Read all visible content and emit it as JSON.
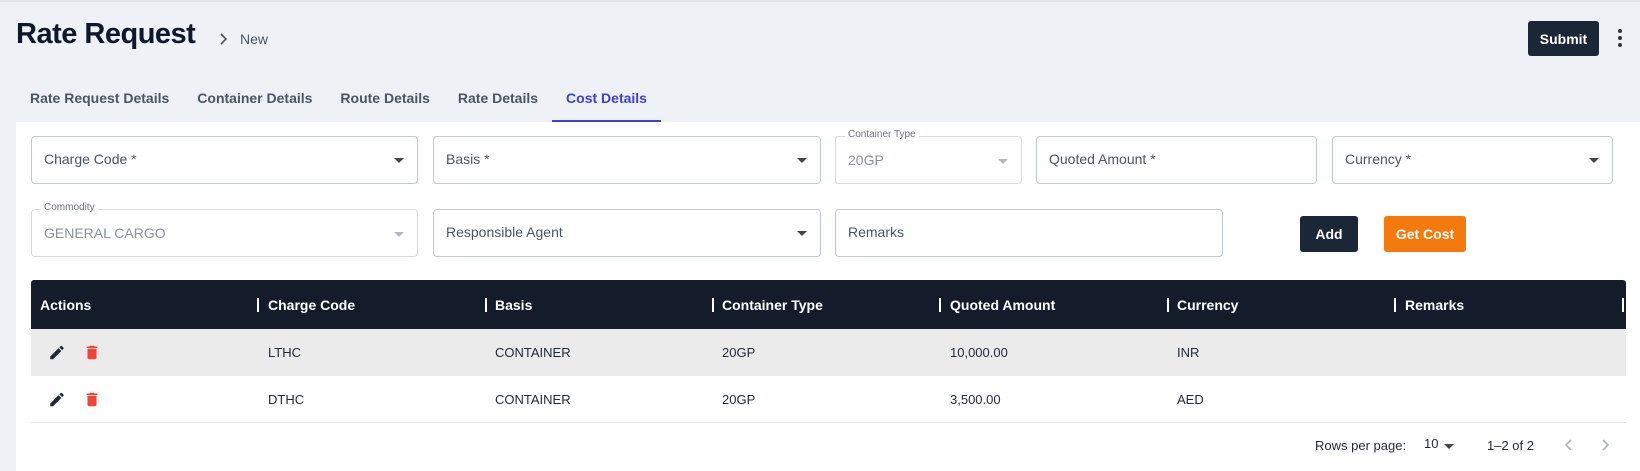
{
  "header": {
    "title": "Rate Request",
    "breadcrumb": "New",
    "submit_label": "Submit"
  },
  "tabs": [
    {
      "label": "Rate Request Details",
      "active": false
    },
    {
      "label": "Container Details",
      "active": false
    },
    {
      "label": "Route Details",
      "active": false
    },
    {
      "label": "Rate Details",
      "active": false
    },
    {
      "label": "Cost Details",
      "active": true
    }
  ],
  "form": {
    "charge_code": {
      "placeholder": "Charge Code *"
    },
    "basis": {
      "placeholder": "Basis *"
    },
    "container_type": {
      "label": "Container Type",
      "value": "20GP"
    },
    "quoted_amount": {
      "placeholder": "Quoted Amount *"
    },
    "currency": {
      "placeholder": "Currency *"
    },
    "commodity": {
      "label": "Commodity",
      "value": "GENERAL CARGO"
    },
    "responsible_agent": {
      "placeholder": "Responsible Agent"
    },
    "remarks": {
      "placeholder": "Remarks"
    },
    "add_label": "Add",
    "get_cost_label": "Get Cost"
  },
  "table": {
    "columns": [
      "Actions",
      "Charge Code",
      "Basis",
      "Container Type",
      "Quoted Amount",
      "Currency",
      "Remarks"
    ],
    "rows": [
      {
        "charge_code": "LTHC",
        "basis": "CONTAINER",
        "container_type": "20GP",
        "quoted_amount": "10,000.00",
        "currency": "INR",
        "remarks": ""
      },
      {
        "charge_code": "DTHC",
        "basis": "CONTAINER",
        "container_type": "20GP",
        "quoted_amount": "3,500.00",
        "currency": "AED",
        "remarks": ""
      }
    ]
  },
  "pagination": {
    "rows_per_page_label": "Rows per page:",
    "rows_per_page": "10",
    "range": "1–2 of 2"
  },
  "colors": {
    "accent": "#3f3fd6",
    "dark_button": "#1b2636",
    "orange_button": "#f57a0d",
    "delete_icon": "#f44336",
    "table_header": "#141c2c"
  },
  "icons": [
    "chevron-right-icon",
    "more-vert-icon",
    "edit-icon",
    "delete-icon",
    "chevron-left-icon"
  ]
}
